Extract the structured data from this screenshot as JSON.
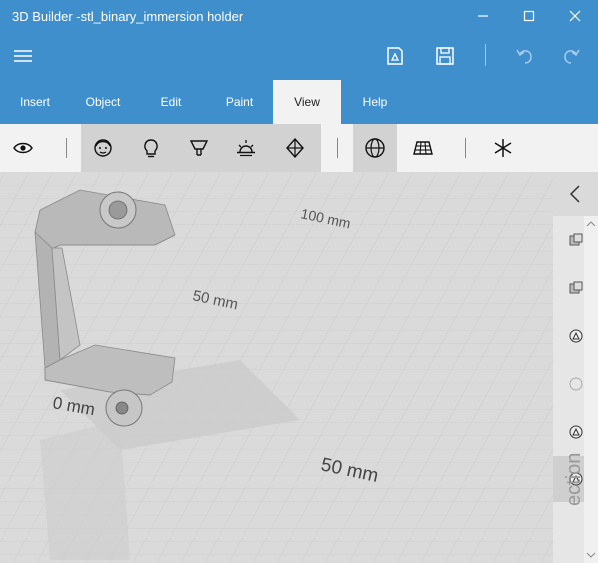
{
  "window": {
    "title": "3D Builder -stl_binary_immersion holder"
  },
  "tabs": [
    {
      "label": "Insert"
    },
    {
      "label": "Object"
    },
    {
      "label": "Edit"
    },
    {
      "label": "Paint"
    },
    {
      "label": "View",
      "active": true
    },
    {
      "label": "Help"
    }
  ],
  "viewport": {
    "labels": {
      "mm100": "100 mm",
      "mm50_back": "50 mm",
      "mm0": "0 mm",
      "mm50_front": "50 mm"
    }
  },
  "side_panel": {
    "label": "ection"
  },
  "colors": {
    "accent": "#3f8fcd",
    "ribbon": "#f2f2f2",
    "ribbon_group": "#d2d2d2",
    "model": "#b8b8b8"
  }
}
